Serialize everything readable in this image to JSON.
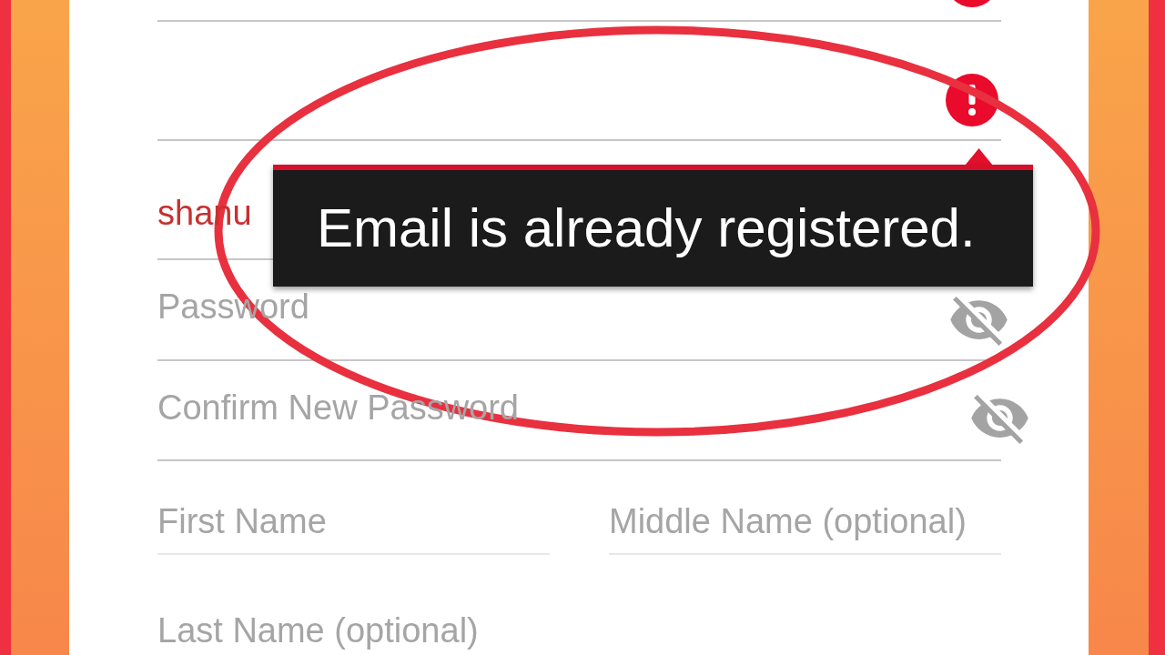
{
  "form": {
    "rows": [
      [
        {
          "kind": "text",
          "error": true
        }
      ],
      [
        {
          "kind": "text",
          "error": true
        }
      ],
      [
        {
          "kind": "text",
          "value": "shanu",
          "error": false
        }
      ],
      [
        {
          "kind": "password",
          "placeholder": "Password",
          "error": false
        }
      ],
      [
        {
          "kind": "password",
          "placeholder": "Confirm New Password",
          "error": false
        }
      ],
      [
        {
          "kind": "text",
          "placeholder": "First Name",
          "error": false
        },
        {
          "kind": "text",
          "placeholder": "Middle Name (optional)",
          "error": false
        }
      ],
      [
        {
          "kind": "text",
          "placeholder": "Last Name (optional)",
          "error": false
        }
      ]
    ]
  },
  "error_tooltip": {
    "text": "Email is already registered."
  },
  "highlight": {
    "kind": "ellipse"
  }
}
